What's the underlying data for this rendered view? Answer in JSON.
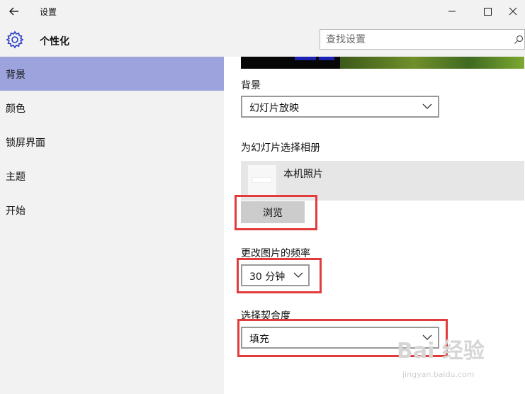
{
  "window": {
    "title": "设置",
    "back_icon": "back-arrow-icon",
    "controls": [
      "minimize-icon",
      "maximize-icon",
      "close-icon"
    ]
  },
  "header": {
    "icon": "gear-icon",
    "title": "个性化",
    "search_placeholder": "查找设置",
    "search_icon": "search-icon"
  },
  "sidebar": {
    "items": [
      {
        "label": "背景",
        "active": true
      },
      {
        "label": "颜色",
        "active": false
      },
      {
        "label": "锁屏界面",
        "active": false
      },
      {
        "label": "主题",
        "active": false
      },
      {
        "label": "开始",
        "active": false
      }
    ],
    "active_color": "#9da4dd"
  },
  "content": {
    "background_label": "背景",
    "background_value": "幻灯片放映",
    "album_label": "为幻灯片选择相册",
    "album_item": "本机照片",
    "browse_button": "浏览",
    "frequency_label": "更改图片的频率",
    "frequency_value": "30 分钟",
    "fit_label": "选择契合度",
    "fit_value": "填充"
  },
  "highlight_color": "#e23b3b",
  "watermark": {
    "text": "Bai 经验",
    "sub": "jingyan.baidu.com"
  }
}
